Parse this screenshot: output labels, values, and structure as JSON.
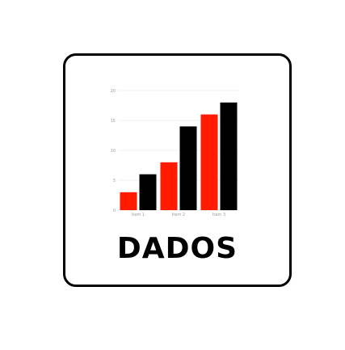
{
  "card": {
    "title": "DADOS"
  },
  "chart_data": {
    "type": "bar",
    "categories": [
      "Item 1",
      "Item 2",
      "Item 3"
    ],
    "series": [
      {
        "values": [
          3,
          8,
          16
        ],
        "color": "#ff1a00"
      },
      {
        "values": [
          6,
          14,
          18
        ],
        "color": "#000000"
      }
    ],
    "yticks": [
      0,
      5,
      10,
      15,
      20
    ],
    "ylim": [
      0,
      20
    ],
    "grid": true
  }
}
